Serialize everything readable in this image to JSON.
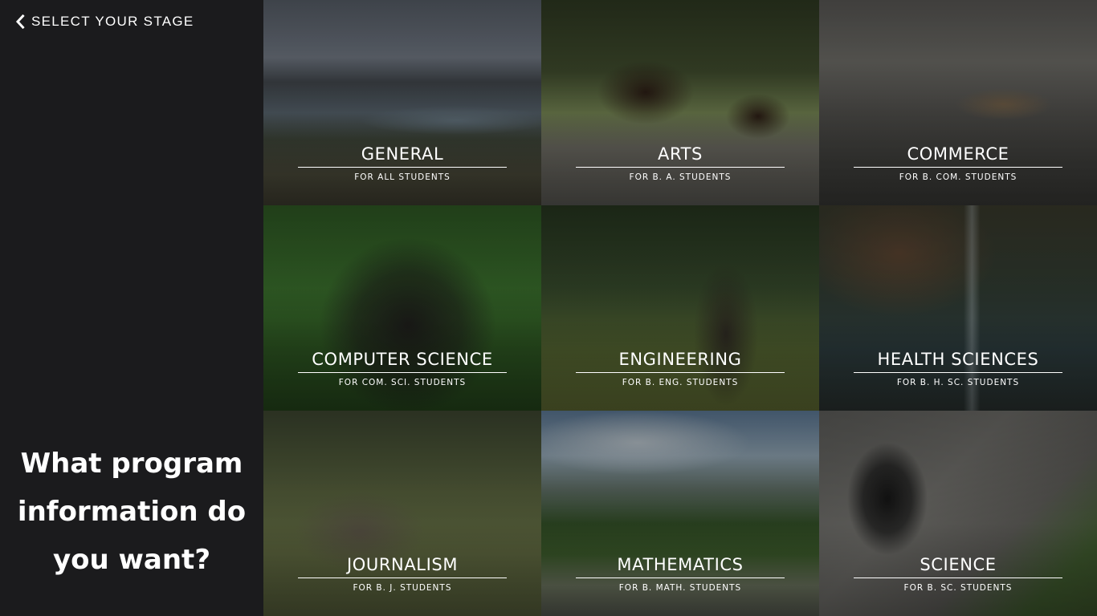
{
  "header": {
    "back_label": "SELECT YOUR STAGE",
    "back_icon": "chevron-left-icon"
  },
  "prompt": {
    "line1": "What program",
    "line2": "information do",
    "line3": "you want?"
  },
  "programs": [
    {
      "title": "GENERAL",
      "subtitle": "FOR ALL STUDENTS"
    },
    {
      "title": "ARTS",
      "subtitle": "FOR B. A. STUDENTS"
    },
    {
      "title": "COMMERCE",
      "subtitle": "FOR B. COM. STUDENTS"
    },
    {
      "title": "COMPUTER SCIENCE",
      "subtitle": "FOR COM. SCI. STUDENTS"
    },
    {
      "title": "ENGINEERING",
      "subtitle": "FOR B. ENG. STUDENTS"
    },
    {
      "title": "HEALTH SCIENCES",
      "subtitle": "FOR B. H. SC. STUDENTS"
    },
    {
      "title": "JOURNALISM",
      "subtitle": "FOR B. J. STUDENTS"
    },
    {
      "title": "MATHEMATICS",
      "subtitle": "FOR B. MATH. STUDENTS"
    },
    {
      "title": "SCIENCE",
      "subtitle": "FOR B. SC. STUDENTS"
    }
  ],
  "colors": {
    "sidebar_bg": "#1b1b1d",
    "text": "#ffffff"
  }
}
